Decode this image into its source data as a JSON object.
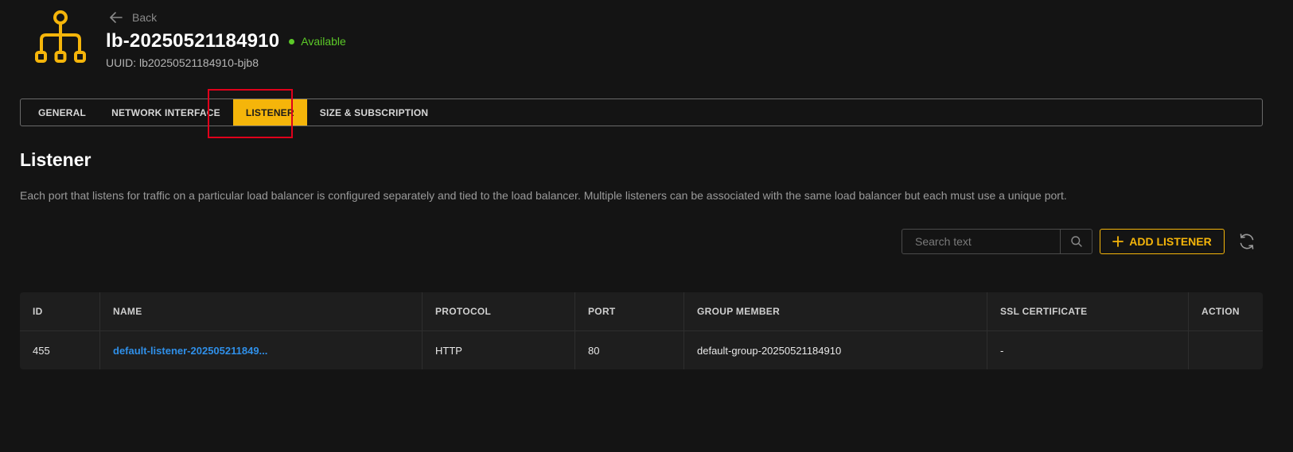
{
  "header": {
    "back_label": "Back",
    "title": "lb-20250521184910",
    "status": "Available",
    "uuid_label": "UUID: lb20250521184910-bjb8",
    "icon": "load-balancer-icon",
    "accent_color": "#f5b50a",
    "status_color": "#5cc928"
  },
  "tabs": [
    {
      "label": "GENERAL",
      "active": false
    },
    {
      "label": "NETWORK INTERFACE",
      "active": false
    },
    {
      "label": "LISTENER",
      "active": true
    },
    {
      "label": "SIZE & SUBSCRIPTION",
      "active": false
    }
  ],
  "section": {
    "title": "Listener",
    "description": "Each port that listens for traffic on a particular load balancer is configured separately and tied to the load balancer. Multiple listeners can be associated with the same load balancer but each must use a unique port."
  },
  "toolbar": {
    "search_placeholder": "Search text",
    "add_label": "ADD LISTENER",
    "search_icon": "search-icon",
    "refresh_icon": "refresh-icon"
  },
  "table": {
    "columns": [
      "ID",
      "NAME",
      "PROTOCOL",
      "PORT",
      "GROUP MEMBER",
      "SSL CERTIFICATE",
      "ACTION"
    ],
    "rows": [
      {
        "id": "455",
        "name": "default-listener-202505211849...",
        "protocol": "HTTP",
        "port": "80",
        "group_member": "default-group-20250521184910",
        "ssl_certificate": "-",
        "action": ""
      }
    ]
  }
}
